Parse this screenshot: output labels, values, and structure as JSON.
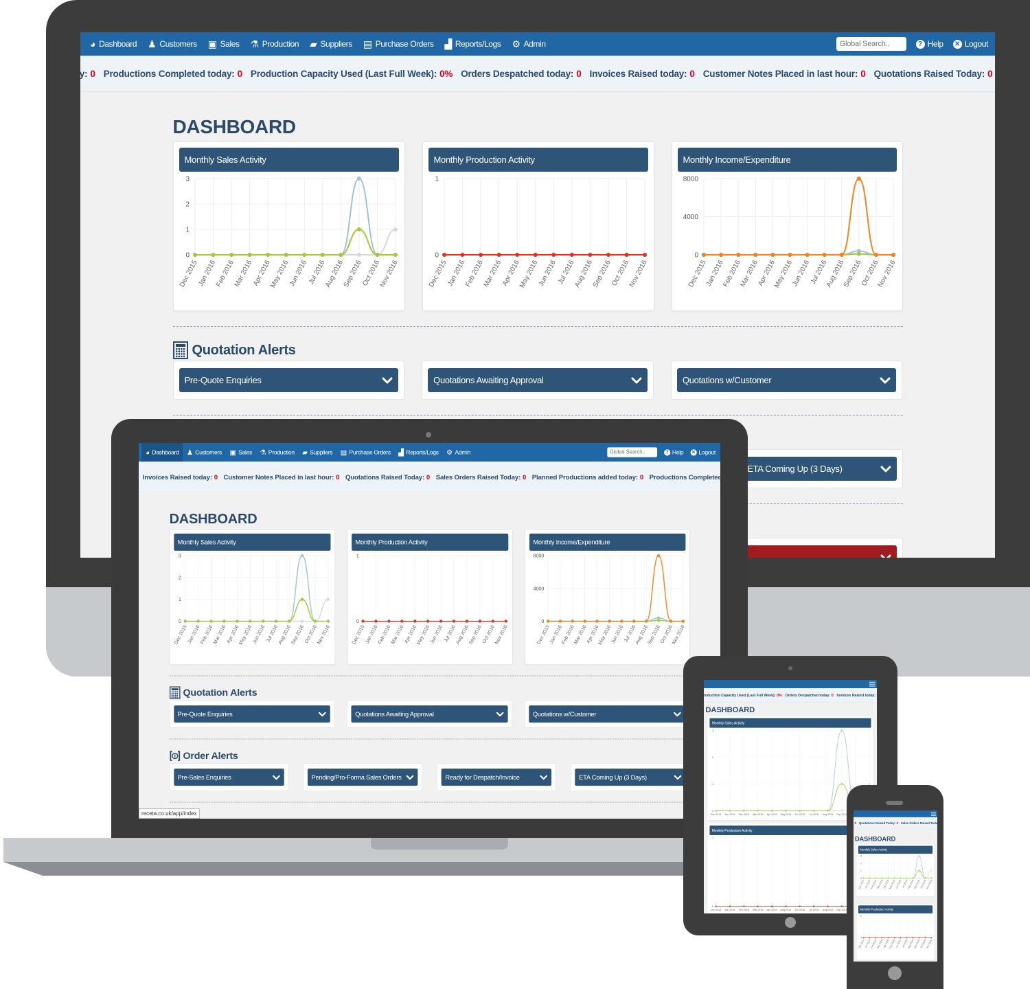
{
  "nav": {
    "items": [
      {
        "label": "Dashboard",
        "icon": "dashboard-icon"
      },
      {
        "label": "Customers",
        "icon": "customers-icon"
      },
      {
        "label": "Sales",
        "icon": "sales-icon"
      },
      {
        "label": "Production",
        "icon": "flask-icon"
      },
      {
        "label": "Suppliers",
        "icon": "truck-icon"
      },
      {
        "label": "Purchase Orders",
        "icon": "document-icon"
      },
      {
        "label": "Reports/Logs",
        "icon": "bar-chart-icon"
      },
      {
        "label": "Admin",
        "icon": "gears-icon"
      }
    ],
    "search_placeholder": "Global Search..",
    "help": "Help",
    "logout": "Logout"
  },
  "ticker": [
    {
      "label": "Quotations Raised Today:",
      "value": "0"
    },
    {
      "label": "Sales Orders Raised Today:",
      "value": "0"
    },
    {
      "label": "Planned Productions added today:",
      "value": "0"
    },
    {
      "label": "Productions Completed today:",
      "value": "0"
    },
    {
      "label": "Production Capacity Used (Last Full Week):",
      "value": "0%"
    },
    {
      "label": "Orders Despatched today:",
      "value": "0"
    },
    {
      "label": "Invoices Raised today:",
      "value": "0"
    },
    {
      "label": "Customer Notes Placed in last hour:",
      "value": "0"
    }
  ],
  "dashboard": {
    "title": "DASHBOARD"
  },
  "chart_data": [
    {
      "type": "line",
      "title": "Monthly Sales Activity",
      "categories": [
        "Dec 2015",
        "Jan 2016",
        "Feb 2016",
        "Mar 2016",
        "Apr 2016",
        "May 2016",
        "Jun 2016",
        "Jul 2016",
        "Aug 2016",
        "Sep 2016",
        "Oct 2016",
        "Nov 2016"
      ],
      "yticks": [
        0,
        1,
        2,
        3
      ],
      "ylim": [
        0,
        3
      ],
      "grid": true,
      "series": [
        {
          "color": "#d8d8d8",
          "values": [
            0,
            0,
            0,
            0,
            0,
            0,
            0,
            0,
            0,
            0,
            0,
            1
          ]
        },
        {
          "color": "#9ec3d9",
          "values": [
            0,
            0,
            0,
            0,
            0,
            0,
            0,
            0,
            0,
            3,
            0,
            0
          ]
        },
        {
          "color": "#a5c83a",
          "values": [
            0,
            0,
            0,
            0,
            0,
            0,
            0,
            0,
            0,
            1,
            0,
            0
          ]
        }
      ]
    },
    {
      "type": "line",
      "title": "Monthly Production Activity",
      "categories": [
        "Dec 2015",
        "Jan 2016",
        "Feb 2016",
        "Mar 2016",
        "Apr 2016",
        "May 2016",
        "Jun 2016",
        "Jul 2016",
        "Aug 2016",
        "Sep 2016",
        "Oct 2016",
        "Nov 2016"
      ],
      "yticks": [
        0,
        1
      ],
      "ylim": [
        0,
        1
      ],
      "grid": true,
      "series": [
        {
          "color": "#e0321e",
          "values": [
            0,
            0,
            0,
            0,
            0,
            0,
            0,
            0,
            0,
            0,
            0,
            0
          ]
        }
      ]
    },
    {
      "type": "line",
      "title": "Monthly Income/Expenditure",
      "categories": [
        "Dec 2015",
        "Jan 2016",
        "Feb 2016",
        "Mar 2016",
        "Apr 2016",
        "May 2016",
        "Jun 2016",
        "Jul 2016",
        "Aug 2016",
        "Sep 2016",
        "Oct 2016",
        "Nov 2016"
      ],
      "yticks": [
        0,
        4000,
        8000
      ],
      "ylim": [
        0,
        8000
      ],
      "grid": true,
      "series": [
        {
          "color": "#9ec3d9",
          "values": [
            0,
            0,
            0,
            0,
            0,
            0,
            0,
            0,
            0,
            400,
            0,
            0
          ]
        },
        {
          "color": "#a5c83a",
          "values": [
            0,
            0,
            0,
            0,
            0,
            0,
            0,
            0,
            0,
            100,
            0,
            0
          ]
        },
        {
          "color": "#f58220",
          "values": [
            0,
            0,
            0,
            0,
            0,
            0,
            0,
            0,
            0,
            8000,
            0,
            0
          ]
        }
      ]
    }
  ],
  "quotation_alerts": {
    "title": "Quotation Alerts",
    "items": [
      "Pre-Quote Enquiries",
      "Quotations Awaiting Approval",
      "Quotations w/Customer"
    ]
  },
  "order_alerts": {
    "title": "Order Alerts",
    "items": [
      "Pre-Sales Enquiries",
      "Pending/Pro-Forma Sales Orders",
      "Ready for Despatch/Invoice",
      "ETA Coming Up (3 Days)"
    ]
  },
  "status_url": "receta.co.uk/app/index",
  "colors": {
    "nav": "#2167a6",
    "card_header": "#2e5578",
    "title": "#2b4a6b",
    "ticker_value": "#d0021b",
    "critical_alert": "#a01c20",
    "device_body": "#3c3c3c",
    "device_silver": "#c6cacd"
  }
}
